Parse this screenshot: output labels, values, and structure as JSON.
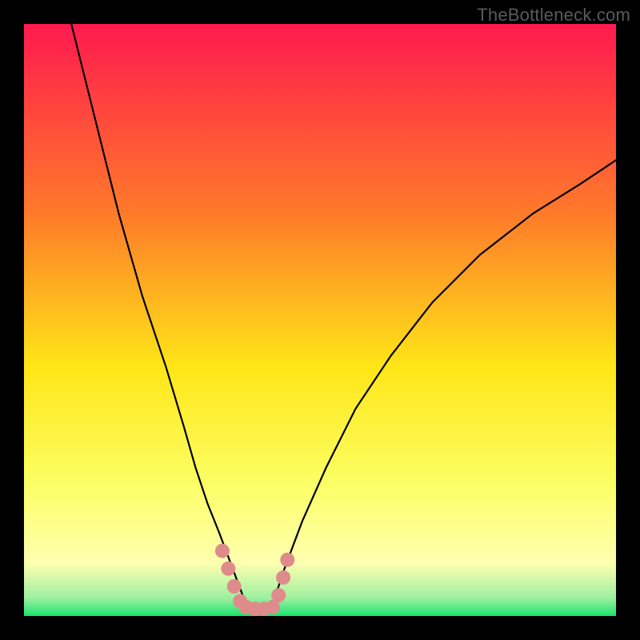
{
  "watermark": "TheBottleneck.com",
  "chart_data": {
    "type": "line",
    "title": "",
    "xlabel": "",
    "ylabel": "",
    "xlim": [
      0,
      100
    ],
    "ylim": [
      0,
      100
    ],
    "gradient_colors": {
      "top": "#ff1a4f",
      "mid_upper": "#ff7a2a",
      "mid": "#ffe617",
      "lower": "#fbff66",
      "band_highlight": "#ffffb0",
      "bottom": "#19e36e"
    },
    "series": [
      {
        "name": "curve-left",
        "x": [
          8,
          12,
          16,
          20,
          24,
          27,
          29,
          31,
          33,
          34.5,
          36,
          37.5
        ],
        "values": [
          100,
          84,
          68,
          54,
          42,
          32,
          25,
          19,
          14,
          10,
          6,
          2
        ]
      },
      {
        "name": "curve-right",
        "x": [
          42,
          44,
          47,
          51,
          56,
          62,
          69,
          77,
          86,
          94,
          100
        ],
        "values": [
          2,
          8,
          16,
          25,
          35,
          44,
          53,
          61,
          68,
          73,
          77
        ]
      }
    ],
    "highlight_band_y": [
      0,
      3
    ],
    "pink_markers": {
      "name": "bottom-highlight",
      "color": "#e08b8b",
      "points": [
        {
          "x": 33.5,
          "y": 11
        },
        {
          "x": 34.5,
          "y": 8
        },
        {
          "x": 35.5,
          "y": 5
        },
        {
          "x": 36.5,
          "y": 2.5
        },
        {
          "x": 37.5,
          "y": 1.5
        },
        {
          "x": 39,
          "y": 1.2
        },
        {
          "x": 40.5,
          "y": 1.2
        },
        {
          "x": 42,
          "y": 1.5
        },
        {
          "x": 43,
          "y": 3.5
        },
        {
          "x": 43.8,
          "y": 6.5
        },
        {
          "x": 44.5,
          "y": 9.5
        }
      ]
    }
  }
}
